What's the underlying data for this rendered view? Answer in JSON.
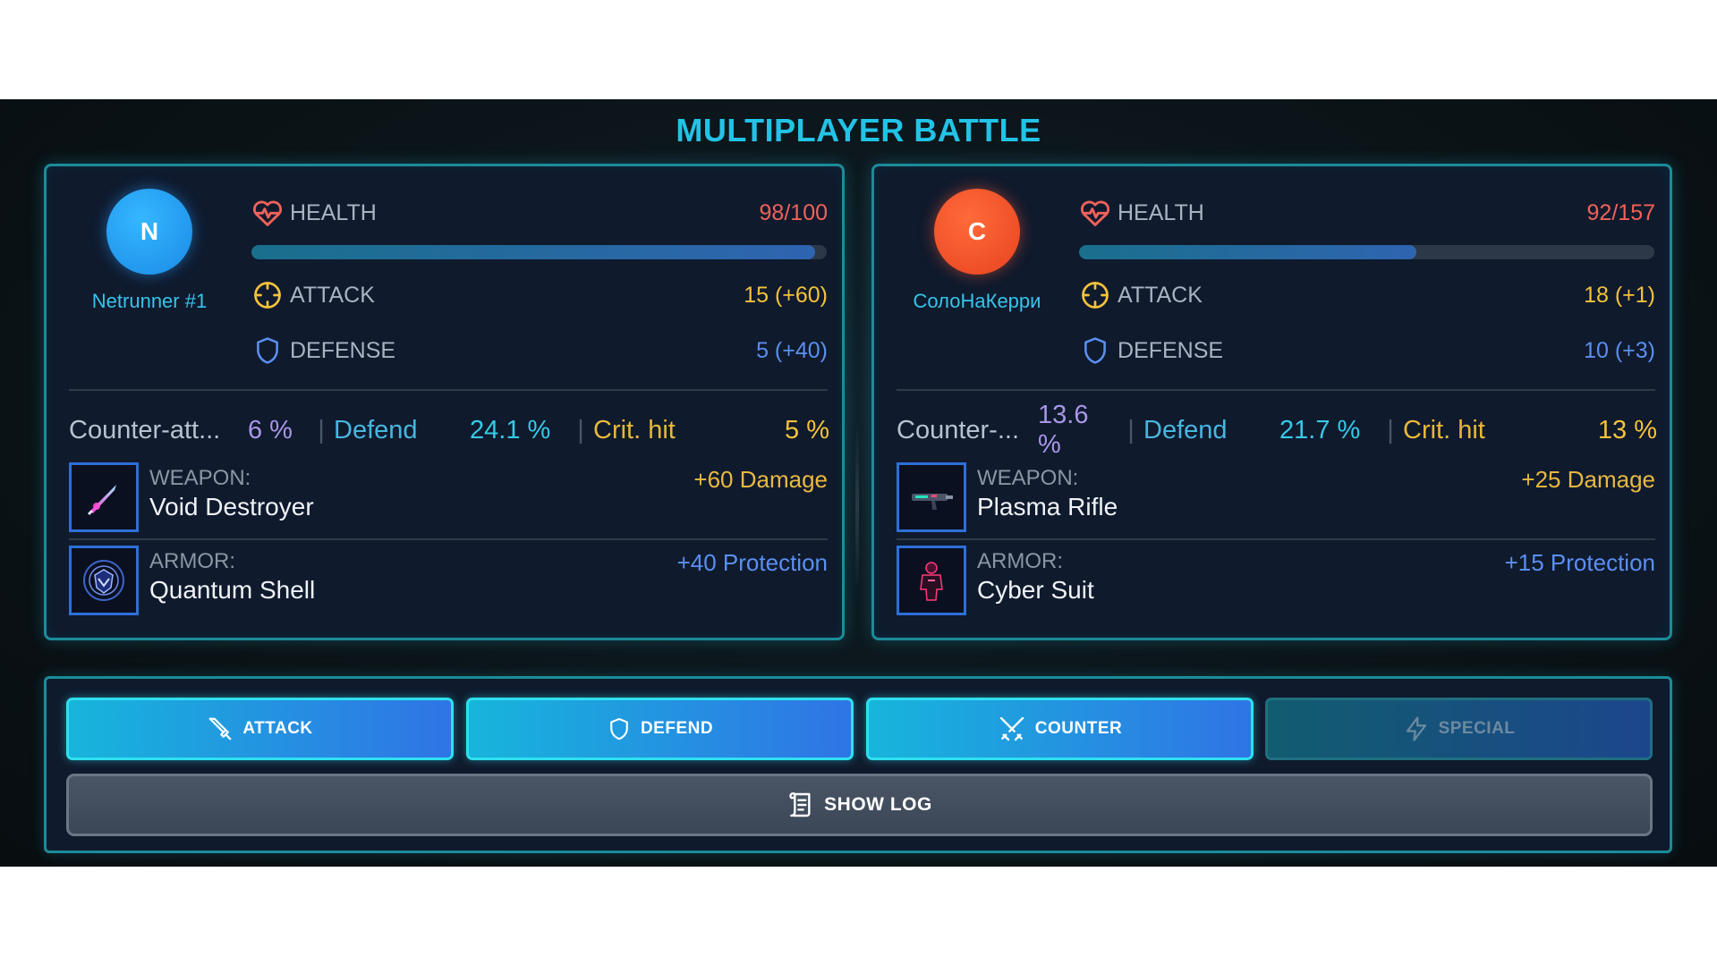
{
  "title": "MULTIPLAYER BATTLE",
  "colors": {
    "accent": "#22c3e6",
    "health": "#f0625a",
    "attack": "#f4c23a",
    "defense": "#5b8ff0",
    "panel": "#0f1a2d",
    "border": "#1b8c99"
  },
  "players": [
    {
      "initial": "N",
      "name": "Netrunner #1",
      "health_label": "HEALTH",
      "health_value": "98/100",
      "health_fraction": 0.98,
      "attack_label": "ATTACK",
      "attack_value": "15 (+60)",
      "defense_label": "DEFENSE",
      "defense_value": "5 (+40)",
      "counter_label": "Counter-att...",
      "counter_value": "6 %",
      "defend_label": "Defend",
      "defend_value": "24.1 %",
      "crit_label": "Crit. hit",
      "crit_value": "5 %",
      "weapon_label": "WEAPON:",
      "weapon_name": "Void Destroyer",
      "weapon_bonus": "+60 Damage",
      "armor_label": "ARMOR:",
      "armor_name": "Quantum Shell",
      "armor_bonus": "+40 Protection"
    },
    {
      "initial": "C",
      "name": "СолоНаКерри",
      "health_label": "HEALTH",
      "health_value": "92/157",
      "health_fraction": 0.586,
      "attack_label": "ATTACK",
      "attack_value": "18 (+1)",
      "defense_label": "DEFENSE",
      "defense_value": "10 (+3)",
      "counter_label": "Counter-...",
      "counter_value": "13.6 %",
      "defend_label": "Defend",
      "defend_value": "21.7 %",
      "crit_label": "Crit. hit",
      "crit_value": "13 %",
      "weapon_label": "WEAPON:",
      "weapon_name": "Plasma Rifle",
      "weapon_bonus": "+25 Damage",
      "armor_label": "ARMOR:",
      "armor_name": "Cyber Suit",
      "armor_bonus": "+15 Protection"
    }
  ],
  "actions": {
    "attack": "ATTACK",
    "defend": "DEFEND",
    "counter": "COUNTER",
    "special": "SPECIAL",
    "log": "SHOW LOG"
  },
  "icons": {
    "health": "heart-pulse-icon",
    "attack": "crosshair-icon",
    "defense": "shield-icon",
    "attack_button": "sword-icon",
    "defend_button": "shield-icon",
    "counter_button": "crossed-swords-icon",
    "special_button": "lightning-icon",
    "log_button": "scroll-icon"
  }
}
